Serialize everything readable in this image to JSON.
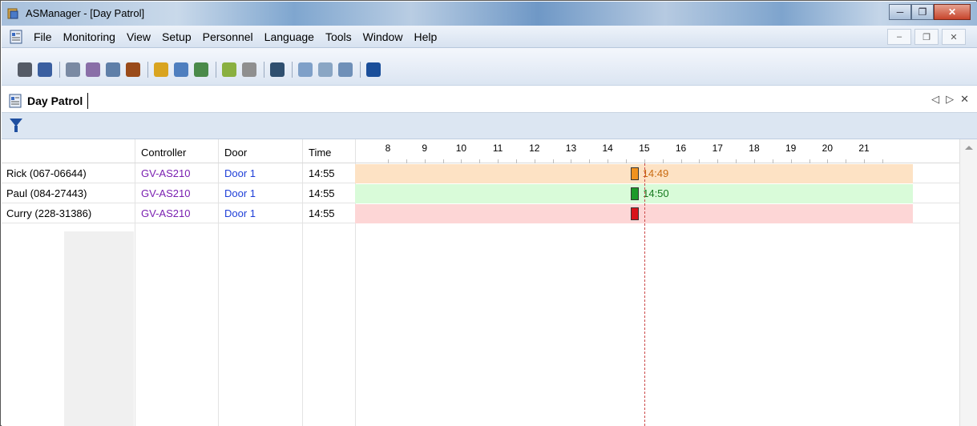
{
  "window": {
    "title": "ASManager - [Day Patrol]"
  },
  "menu": {
    "items": [
      "File",
      "Monitoring",
      "View",
      "Setup",
      "Personnel",
      "Language",
      "Tools",
      "Window",
      "Help"
    ]
  },
  "toolbar": {
    "icons": [
      "login-icon",
      "logout-icon",
      "settings-icon",
      "controller-icon",
      "device-icon",
      "door-icon",
      "clock-icon",
      "users-icon",
      "schedule-icon",
      "map-icon",
      "zoom-icon",
      "person-icon",
      "message-icon",
      "vehicle-icon",
      "chat-icon",
      "help-icon"
    ],
    "icon_colors": [
      "#555b66",
      "#3a5fa0",
      "#7a8aa3",
      "#8a6fa8",
      "#5f7fa8",
      "#9a4b1a",
      "#d9a420",
      "#4f7fbf",
      "#4a8a4a",
      "#8ab040",
      "#8f8f8f",
      "#2f4f6f",
      "#7fa0c8",
      "#8aa6c4",
      "#6f90b8",
      "#1b4f9a"
    ],
    "groups": [
      2,
      4,
      3,
      2,
      1,
      3,
      1
    ]
  },
  "tab": {
    "label": "Day Patrol"
  },
  "grid": {
    "headers": {
      "name": "",
      "controller": "Controller",
      "door": "Door",
      "time": "Time"
    },
    "hours": [
      "8",
      "9",
      "10",
      "11",
      "12",
      "13",
      "14",
      "15",
      "16",
      "17",
      "18",
      "19",
      "20",
      "21"
    ],
    "hour_start": 8,
    "hour_end": 24.5,
    "current_hour": 15,
    "rows": [
      {
        "name": "Rick (067-06644)",
        "controller": "GV-AS210",
        "door": "Door 1",
        "time": "14:55",
        "event_time": "14:49",
        "event_hour": 14.82,
        "band_color": "#fde2c4",
        "marker_color": "#f0921e",
        "time_color": "#c96a10"
      },
      {
        "name": "Paul (084-27443)",
        "controller": "GV-AS210",
        "door": "Door 1",
        "time": "14:55",
        "event_time": "14:50",
        "event_hour": 14.83,
        "band_color": "#d9fbd9",
        "marker_color": "#1c9a2a",
        "time_color": "#167a1e"
      },
      {
        "name": "Curry (228-31386)",
        "controller": "GV-AS210",
        "door": "Door 1",
        "time": "14:55",
        "event_time": "",
        "event_hour": 14.83,
        "band_color": "#fdd6d6",
        "marker_color": "#d8141a",
        "time_color": "#b01010"
      }
    ],
    "controller_color": "#7a1fb0",
    "door_color": "#1f3fd8"
  }
}
